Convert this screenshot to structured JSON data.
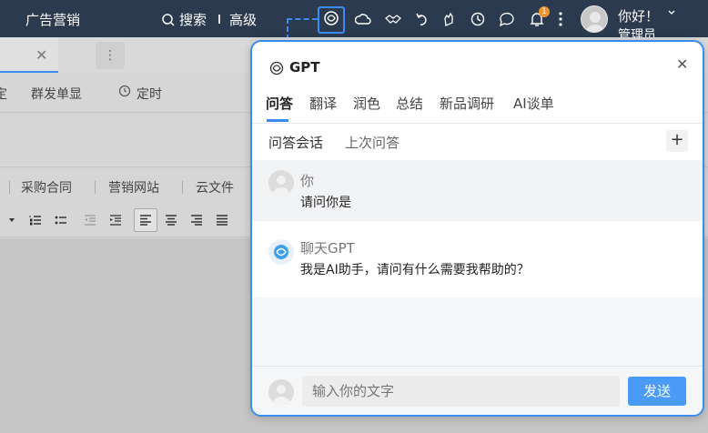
{
  "topbar": {
    "ad_marketing": "广告营销",
    "search": "搜索",
    "advanced": "高级",
    "notification_count": "1",
    "greeting": "你好！",
    "role": "管理员",
    "icons": [
      "gpt-icon",
      "cloud-icon",
      "handshake-icon",
      "undo-icon",
      "hand-icon",
      "clock-icon",
      "chat-icon",
      "bell-icon",
      "more-vert-icon"
    ]
  },
  "background": {
    "row1": [
      "群发单显",
      "定时"
    ],
    "row3": [
      "采购合同",
      "营销网站",
      "云文件"
    ]
  },
  "panel": {
    "title": "GPT",
    "tabs": [
      "问答",
      "翻译",
      "润色",
      "总结",
      "新品调研",
      "AI谈单"
    ],
    "subtabs": [
      "问答会话",
      "上次问答"
    ],
    "messages": [
      {
        "name": "你",
        "text": "请问你是"
      },
      {
        "name": "聊天GPT",
        "text": "我是AI助手，请问有什么需要我帮助的？"
      }
    ],
    "input_placeholder": "输入你的文字",
    "send_label": "发送"
  },
  "colors": {
    "accent": "#3b8cf0",
    "topbar": "#2b3a4e",
    "send": "#4a9bf5"
  }
}
